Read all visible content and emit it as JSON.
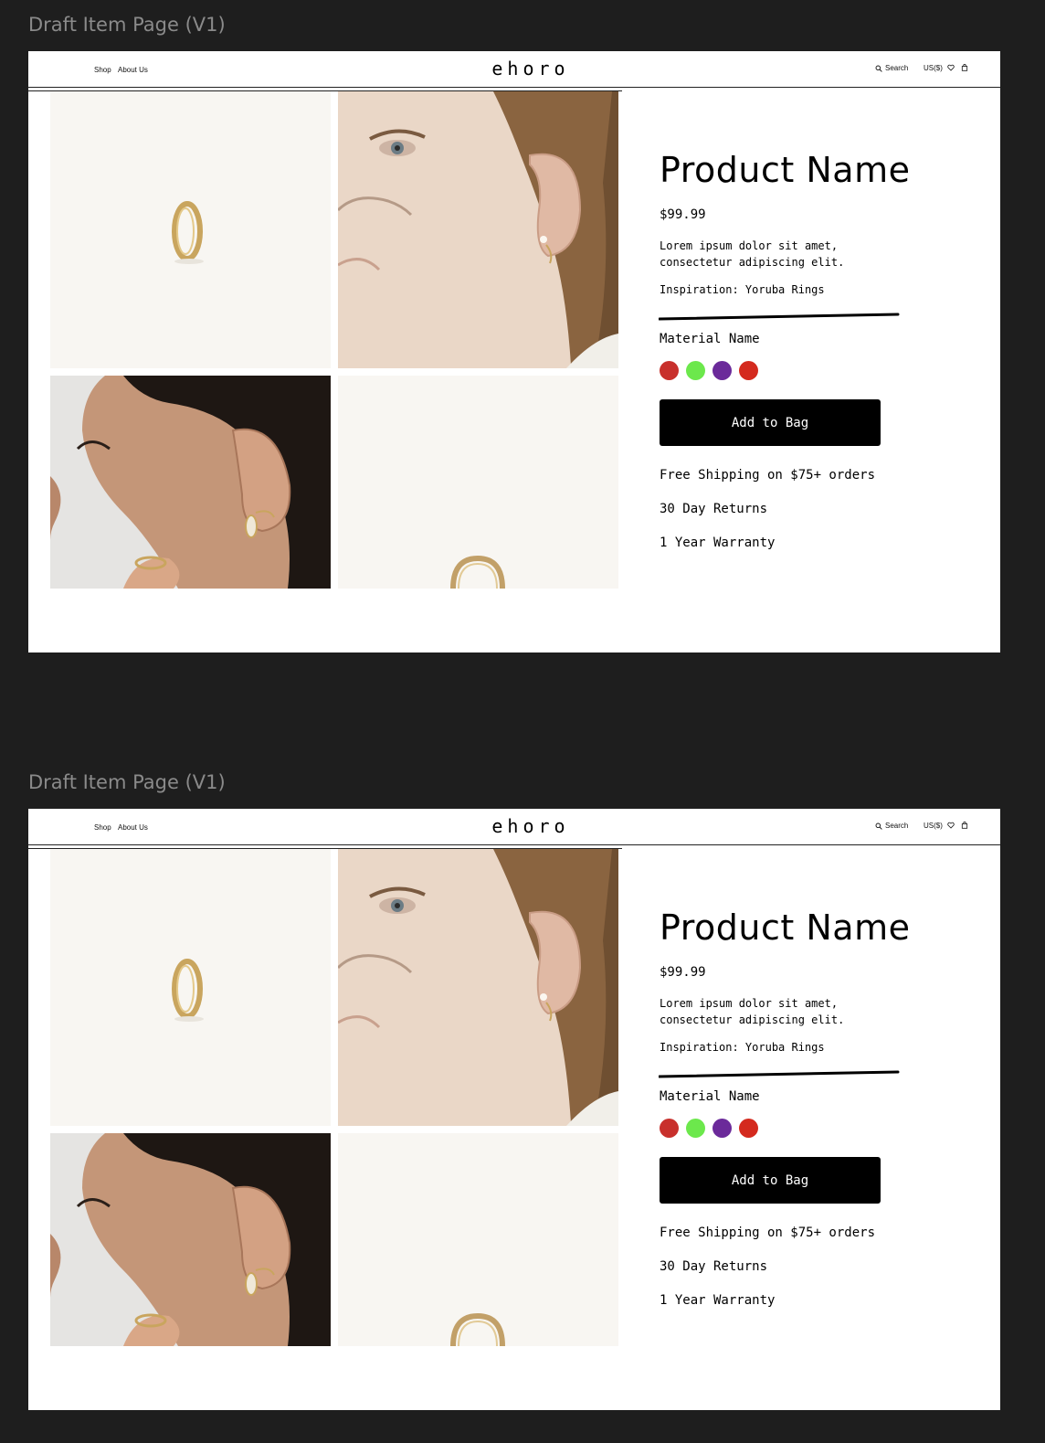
{
  "frames": [
    {
      "label": "Draft Item Page (V1)",
      "nav": {
        "shop": "Shop",
        "about": "About Us"
      },
      "brand": "ehoro",
      "header_right": {
        "search": "Search",
        "currency": "US($)"
      },
      "product": {
        "name": "Product Name",
        "price": "$99.99",
        "description": "Lorem ipsum dolor sit amet, consectetur adipiscing elit.",
        "inspiration": "Inspiration: Yoruba Rings",
        "material_label": "Material Name",
        "swatches": [
          "#c8302c",
          "#6ce84c",
          "#6b2a9a",
          "#d42a1e"
        ],
        "add_to_bag": "Add to Bag",
        "perks": [
          "Free Shipping on $75+ orders",
          "30 Day Returns",
          "1 Year Warranty"
        ]
      }
    },
    {
      "label": "Draft Item Page (V1)",
      "nav": {
        "shop": "Shop",
        "about": "About Us"
      },
      "brand": "ehoro",
      "header_right": {
        "search": "Search",
        "currency": "US($)"
      },
      "product": {
        "name": "Product Name",
        "price": "$99.99",
        "description": "Lorem ipsum dolor sit amet, consectetur adipiscing elit.",
        "inspiration": "Inspiration: Yoruba Rings",
        "material_label": "Material Name",
        "swatches": [
          "#c8302c",
          "#6ce84c",
          "#6b2a9a",
          "#d42a1e"
        ],
        "add_to_bag": "Add to Bag",
        "perks": [
          "Free Shipping on $75+ orders",
          "30 Day Returns",
          "1 Year Warranty"
        ]
      }
    }
  ]
}
